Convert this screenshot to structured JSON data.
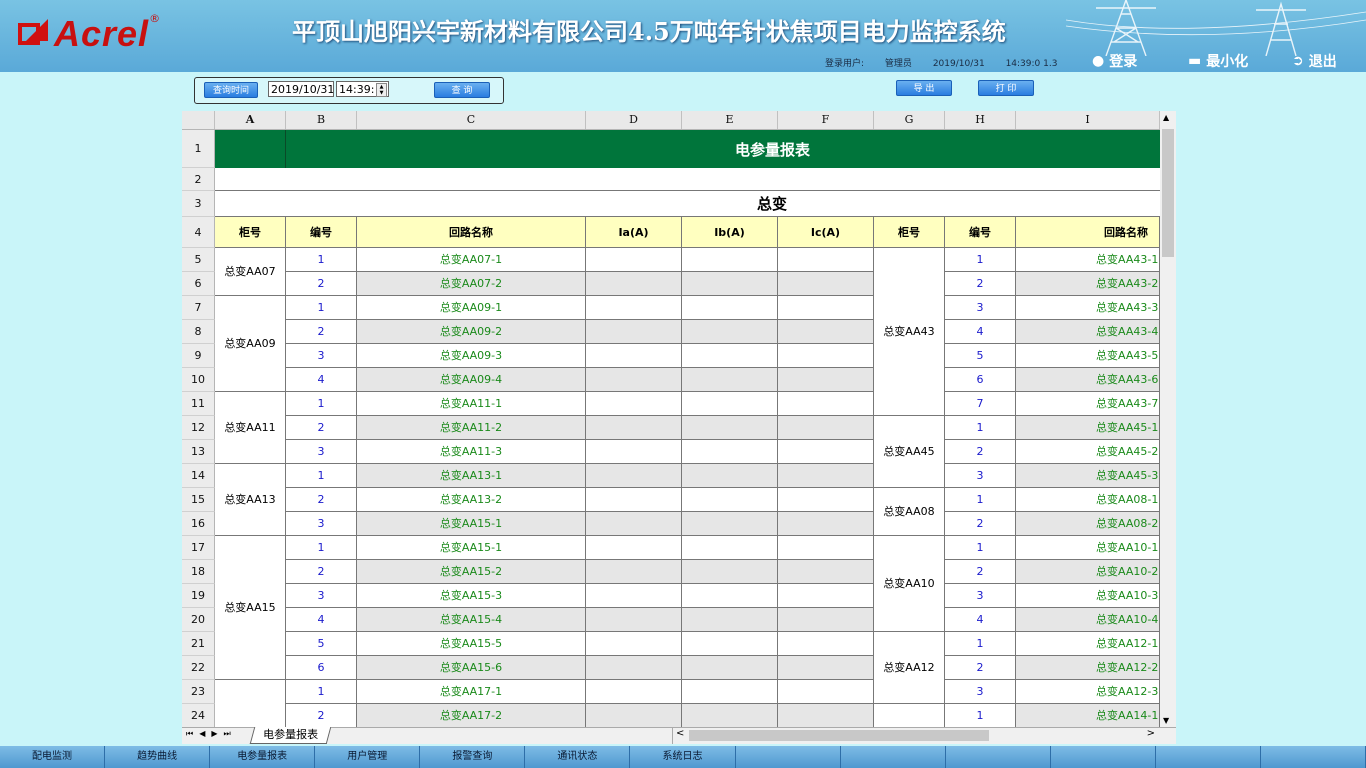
{
  "header": {
    "logo_text": "Acrel",
    "logo_reg": "®",
    "system_title": "平顶山旭阳兴宇新材料有限公司4.5万吨年针状焦项目电力监控系统",
    "user_label": "登录用户:",
    "user_name": "管理员",
    "date": "2019/10/31",
    "time": "14:39:0 1.3",
    "login_label": "登录",
    "minimize_label": "最小化",
    "exit_label": "退出"
  },
  "toolbar": {
    "query_time_label": "查询时间",
    "date_value": "2019/10/31",
    "time_value": "14:39:",
    "query_label": "查 询",
    "export_label": "导 出",
    "print_label": "打 印"
  },
  "columns": [
    "A",
    "B",
    "C",
    "D",
    "E",
    "F",
    "G",
    "H",
    "I"
  ],
  "sheet": {
    "report_title": "电参量报表",
    "section_title": "总变",
    "headers": [
      "柜号",
      "编号",
      "回路名称",
      "Ia(A)",
      "Ib(A)",
      "Ic(A)",
      "柜号",
      "编号",
      "回路名称"
    ],
    "left": [
      {
        "cabinet": "总变AA07",
        "rows": [
          [
            "1",
            "总变AA07-1"
          ],
          [
            "2",
            "总变AA07-2"
          ]
        ]
      },
      {
        "cabinet": "总变AA09",
        "rows": [
          [
            "1",
            "总变AA09-1"
          ],
          [
            "2",
            "总变AA09-2"
          ],
          [
            "3",
            "总变AA09-3"
          ],
          [
            "4",
            "总变AA09-4"
          ]
        ]
      },
      {
        "cabinet": "总变AA11",
        "rows": [
          [
            "1",
            "总变AA11-1"
          ],
          [
            "2",
            "总变AA11-2"
          ],
          [
            "3",
            "总变AA11-3"
          ]
        ]
      },
      {
        "cabinet": "总变AA13",
        "rows": [
          [
            "1",
            "总变AA13-1"
          ],
          [
            "2",
            "总变AA13-2"
          ],
          [
            "3",
            "总变AA15-1"
          ]
        ]
      },
      {
        "cabinet": "总变AA15",
        "rows": [
          [
            "1",
            "总变AA15-1"
          ],
          [
            "2",
            "总变AA15-2"
          ],
          [
            "3",
            "总变AA15-3"
          ],
          [
            "4",
            "总变AA15-4"
          ],
          [
            "5",
            "总变AA15-5"
          ],
          [
            "6",
            "总变AA15-6"
          ]
        ]
      },
      {
        "cabinet": "",
        "rows": [
          [
            "1",
            "总变AA17-1"
          ],
          [
            "2",
            "总变AA17-2"
          ]
        ]
      }
    ],
    "right": [
      {
        "cabinet": "总变AA43",
        "rows": [
          [
            "1",
            "总变AA43-1"
          ],
          [
            "2",
            "总变AA43-2"
          ],
          [
            "3",
            "总变AA43-3"
          ],
          [
            "4",
            "总变AA43-4"
          ],
          [
            "5",
            "总变AA43-5"
          ],
          [
            "6",
            "总变AA43-6"
          ],
          [
            "7",
            "总变AA43-7"
          ]
        ]
      },
      {
        "cabinet": "总变AA45",
        "rows": [
          [
            "1",
            "总变AA45-1"
          ],
          [
            "2",
            "总变AA45-2"
          ],
          [
            "3",
            "总变AA45-3"
          ]
        ]
      },
      {
        "cabinet": "总变AA08",
        "rows": [
          [
            "1",
            "总变AA08-1"
          ],
          [
            "2",
            "总变AA08-2"
          ]
        ]
      },
      {
        "cabinet": "总变AA10",
        "rows": [
          [
            "1",
            "总变AA10-1"
          ],
          [
            "2",
            "总变AA10-2"
          ],
          [
            "3",
            "总变AA10-3"
          ],
          [
            "4",
            "总变AA10-4"
          ]
        ]
      },
      {
        "cabinet": "总变AA12",
        "rows": [
          [
            "1",
            "总变AA12-1"
          ],
          [
            "2",
            "总变AA12-2"
          ],
          [
            "3",
            "总变AA12-3"
          ]
        ]
      },
      {
        "cabinet": "",
        "rows": [
          [
            "1",
            "总变AA14-1"
          ]
        ]
      }
    ],
    "row_numbers": [
      "1",
      "2",
      "3",
      "4",
      "5",
      "6",
      "7",
      "8",
      "9",
      "10",
      "11",
      "12",
      "13",
      "14",
      "15",
      "16",
      "17",
      "18",
      "19",
      "20",
      "21",
      "22",
      "23",
      "24"
    ],
    "tab_label": "电参量报表"
  },
  "footer": {
    "items": [
      "配电监测",
      "趋势曲线",
      "电参量报表",
      "用户管理",
      "报警查询",
      "通讯状态",
      "系统日志",
      "",
      "",
      "",
      "",
      "",
      ""
    ]
  },
  "colors": {
    "title_green": "#00753b",
    "header_yellow": "#ffffc0",
    "link_green": "#1a8a1a",
    "num_blue": "#1a1acc",
    "row_gray": "#e6e6e6"
  }
}
